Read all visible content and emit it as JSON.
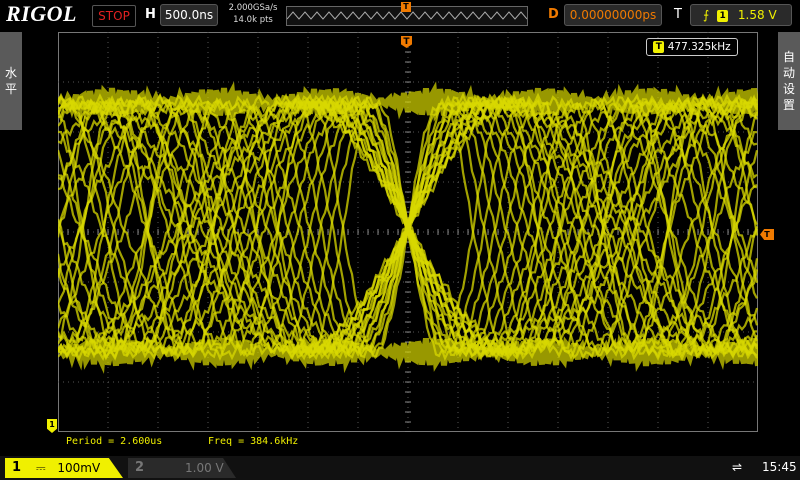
{
  "brand": "RIGOL",
  "status": {
    "run_state": "STOP",
    "state_color": "#e02020"
  },
  "horizontal": {
    "label": "H",
    "scale": "500.0ns",
    "sample_rate": "2.000GSa/s",
    "memory_depth": "14.0k pts"
  },
  "delay": {
    "label": "D",
    "value": "0.00000000ps"
  },
  "trigger": {
    "label": "T",
    "source": "1",
    "level": "1.58 V",
    "marker": "T"
  },
  "side_left": {
    "label": "水平"
  },
  "side_right": {
    "label": "自动设置"
  },
  "freq_counter": {
    "value": "477.325kHz"
  },
  "measurements": {
    "period": "Period = 2.600us",
    "freq": "Freq = 384.6kHz"
  },
  "channels": [
    {
      "num": "1",
      "scale": "100mV",
      "color": "#f0f000",
      "active": true
    },
    {
      "num": "2",
      "scale": "1.00 V",
      "color": "#00e0e0",
      "active": false
    }
  ],
  "clock": "15:45",
  "colors": {
    "trace": "#d8d800",
    "grid": "#555555",
    "accent": "#f07a00"
  }
}
